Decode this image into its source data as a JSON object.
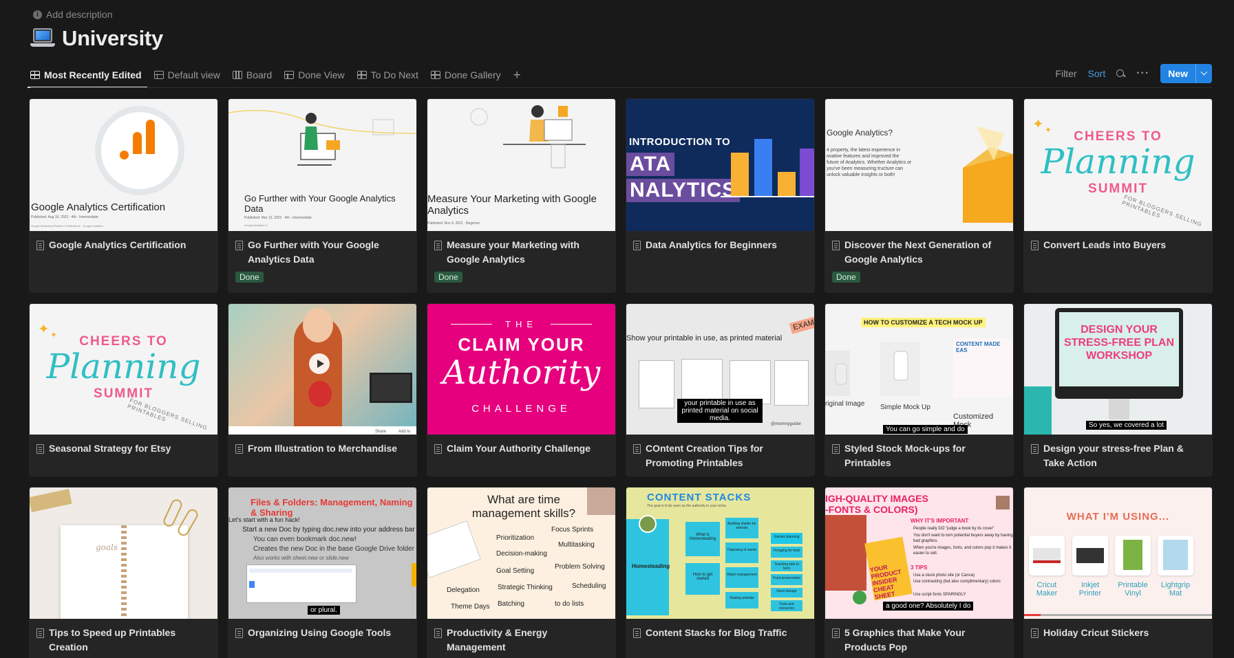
{
  "header": {
    "add_description": "Add description",
    "title": "University",
    "icon": "laptop-icon"
  },
  "tabs": [
    {
      "label": "Most Recently Edited",
      "icon": "gallery-icon",
      "active": true
    },
    {
      "label": "Default view",
      "icon": "table-icon"
    },
    {
      "label": "Board",
      "icon": "board-icon"
    },
    {
      "label": "Done View",
      "icon": "table-icon"
    },
    {
      "label": "To Do Next",
      "icon": "gallery-icon"
    },
    {
      "label": "Done Gallery",
      "icon": "gallery-icon"
    }
  ],
  "toolbar": {
    "filter": "Filter",
    "sort": "Sort",
    "more": "···",
    "new": "New"
  },
  "colors": {
    "accent": "#2383e2",
    "sort": "#4a9fe6",
    "done_badge": "#2b593f",
    "background": "#191919",
    "card": "#252525"
  },
  "cards": [
    {
      "title": "Google Analytics Certification",
      "thumb_text": "Google Analytics Certification",
      "thumb_meta": "Published: Aug 16, 2022 · 4th · Intermediate",
      "thumb_sub": "Google Marketing Platform Certifications · Google Analytics"
    },
    {
      "title": "Go Further with Your Google Analytics Data",
      "badge": "Done",
      "thumb_text": "Go Further with Your Google Analytics Data",
      "thumb_meta": "Published: Mar 12, 2022 · 4th · Intermediate",
      "thumb_sub": "Google Analytics 4"
    },
    {
      "title": "Measure your Marketing with Google Analytics",
      "badge": "Done",
      "thumb_text": "Measure Your Marketing with Google Analytics",
      "thumb_meta": "Published: Nov 9, 2021 · Beginner"
    },
    {
      "title": "Data Analytics for Beginners",
      "thumb_text": "INTRODUCTION TO",
      "thumb_text2": "ATA",
      "thumb_text3": "NALYTICS"
    },
    {
      "title": "Discover the Next Generation of Google Analytics",
      "badge": "Done",
      "thumb_text": "Google Analytics?",
      "thumb_body": "4 property, the latest experience in ovative features and improved the future of Analytics. Whether Analytics or you've been measuring tructure can unlock valuable insights or both!"
    },
    {
      "title": "Convert Leads into Buyers",
      "thumb_text": "CHEERS TO",
      "thumb_text2": "Planning",
      "thumb_text3": "SUMMIT",
      "thumb_text4": "FOR BLOGGERS SELLING PRINTABLES"
    },
    {
      "title": "Seasonal Strategy for Etsy",
      "thumb_text": "CHEERS TO",
      "thumb_text2": "Planning",
      "thumb_text3": "SUMMIT",
      "thumb_text4": "FOR BLOGGERS SELLING PRINTABLES"
    },
    {
      "title": "From Illustration to Merchandise",
      "thumb_text": "Share",
      "thumb_text2": "Add to"
    },
    {
      "title": "Claim Your Authority Challenge",
      "thumb_text": "THE",
      "thumb_text2": "CLAIM YOUR",
      "thumb_text3": "Authority",
      "thumb_text4": "CHALLENGE"
    },
    {
      "title": "COntent Creation Tips for Promoting Printables",
      "thumb_text": "Show your printable in use, as printed material",
      "thumb_text2": "EXAMP",
      "thumb_caption": "your printable in use as printed material on social media.",
      "thumb_handle": "@mommyguider"
    },
    {
      "title": "Styled Stock Mock-ups for Printables",
      "thumb_text": "HOW TO CUSTOMIZE A TECH MOCK UP",
      "thumb_text2": "CONTENT MADE EAS",
      "thumb_label1": "riginal Image",
      "thumb_label2": "Simple Mock Up",
      "thumb_label3": "Customized Mock",
      "thumb_caption": "You can go simple and do"
    },
    {
      "title": "Design your stress-free Plan & Take Action",
      "thumb_text": "DESIGN YOUR STRESS-FREE PLAN WORKSHOP",
      "thumb_caption": "So yes, we covered a lot"
    },
    {
      "title": "Tips to Speed up Printables Creation",
      "thumb_text": "goals"
    },
    {
      "title": "Organizing Using Google Tools",
      "thumb_text": "Files & Folders: Management, Naming & Sharing",
      "thumb_lines": [
        "Let's start with a fun hack!",
        "Start a new Doc by typing doc.new into your address bar",
        "You can even bookmark doc.new!",
        "Creates the new Doc in the base Google Drive folder",
        "Also works with sheet.new or slide.new"
      ],
      "thumb_caption": "or plural."
    },
    {
      "title": "Productivity & Energy Management",
      "thumb_text": "What are time management skills?",
      "thumb_items": [
        "Focus Sprints",
        "Prioritization",
        "Multitasking",
        "Decision-making",
        "Goal Setting",
        "Problem Solving",
        "Strategic Thinking",
        "Scheduling",
        "Delegation",
        "Batching",
        "to do lists",
        "Theme Days"
      ]
    },
    {
      "title": "Content Stacks for Blog Traffic",
      "thumb_text": "CONTENT STACKS",
      "thumb_sub": "The goal is to be seen as the authority in your niche.",
      "thumb_items": [
        "Homesteading",
        "What is Homesteading",
        "How to get started",
        "Building shelter for animals",
        "Disposing of waste",
        "Water management",
        "Raising animals",
        "Garden planning",
        "Foraging for food",
        "Teaching kids to farm",
        "Food preservation",
        "Seed storage",
        "Tools and resources"
      ]
    },
    {
      "title": "5 Graphics that Make Your Products Pop",
      "thumb_text": "IGH-QUALITY IMAGES",
      "thumb_text2": "-FONTS & COLORS)",
      "thumb_sub": "WHY IT'S IMPORTANT",
      "thumb_lines": [
        "People really DO \"judge a book by its cover\"",
        "You don't want to turn potential buyers away by having bad graphics.",
        "When you're images, fonts, and colors pop it makes it easier to sell."
      ],
      "thumb_sub2": "3 TIPS",
      "thumb_lines2": [
        "Use a stock photo site (or Canva)",
        "Use contrasting (but also complimentary) colors",
        "Use script fonts SPARINGLY"
      ],
      "thumb_badge": "YOUR PRODUCT INSIDER CHEAT SHEET",
      "thumb_caption": "a good one? Absolutely I do"
    },
    {
      "title": "Holiday Cricut Stickers",
      "thumb_text": "WHAT I'M USING...",
      "thumb_items": [
        "Cricut Maker",
        "Inkjet Printer",
        "Printable Vinyl",
        "Lightgrip Mat"
      ]
    }
  ]
}
